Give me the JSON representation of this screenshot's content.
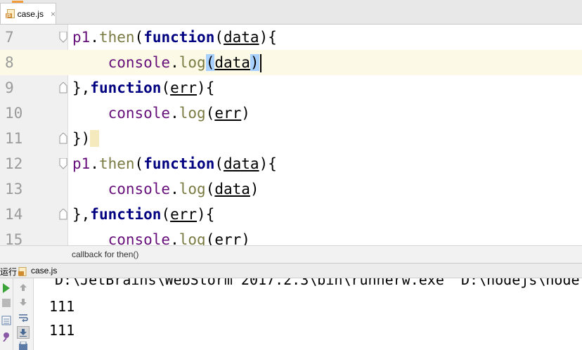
{
  "tab": {
    "filename": "case.js",
    "close": "×",
    "icon": "js-file-icon"
  },
  "editor": {
    "lines": [
      {
        "num": "7"
      },
      {
        "num": "8"
      },
      {
        "num": "9"
      },
      {
        "num": "10"
      },
      {
        "num": "11"
      },
      {
        "num": "12"
      },
      {
        "num": "13"
      },
      {
        "num": "14"
      },
      {
        "num": "15"
      }
    ]
  },
  "breadcrumb": {
    "text": "callback for then()"
  },
  "run": {
    "title": "运行",
    "filename": "case.js",
    "command": "D:\\JetBrains\\WebStorm 2017.2.3\\bin\\runnerw.exe\" D:\\nodejs\\node.",
    "output": [
      "111",
      "111"
    ]
  },
  "colors": {
    "keyword": "#000080",
    "variable": "#660e7a",
    "function": "#7a7a43",
    "current_line": "#fcfae6"
  }
}
